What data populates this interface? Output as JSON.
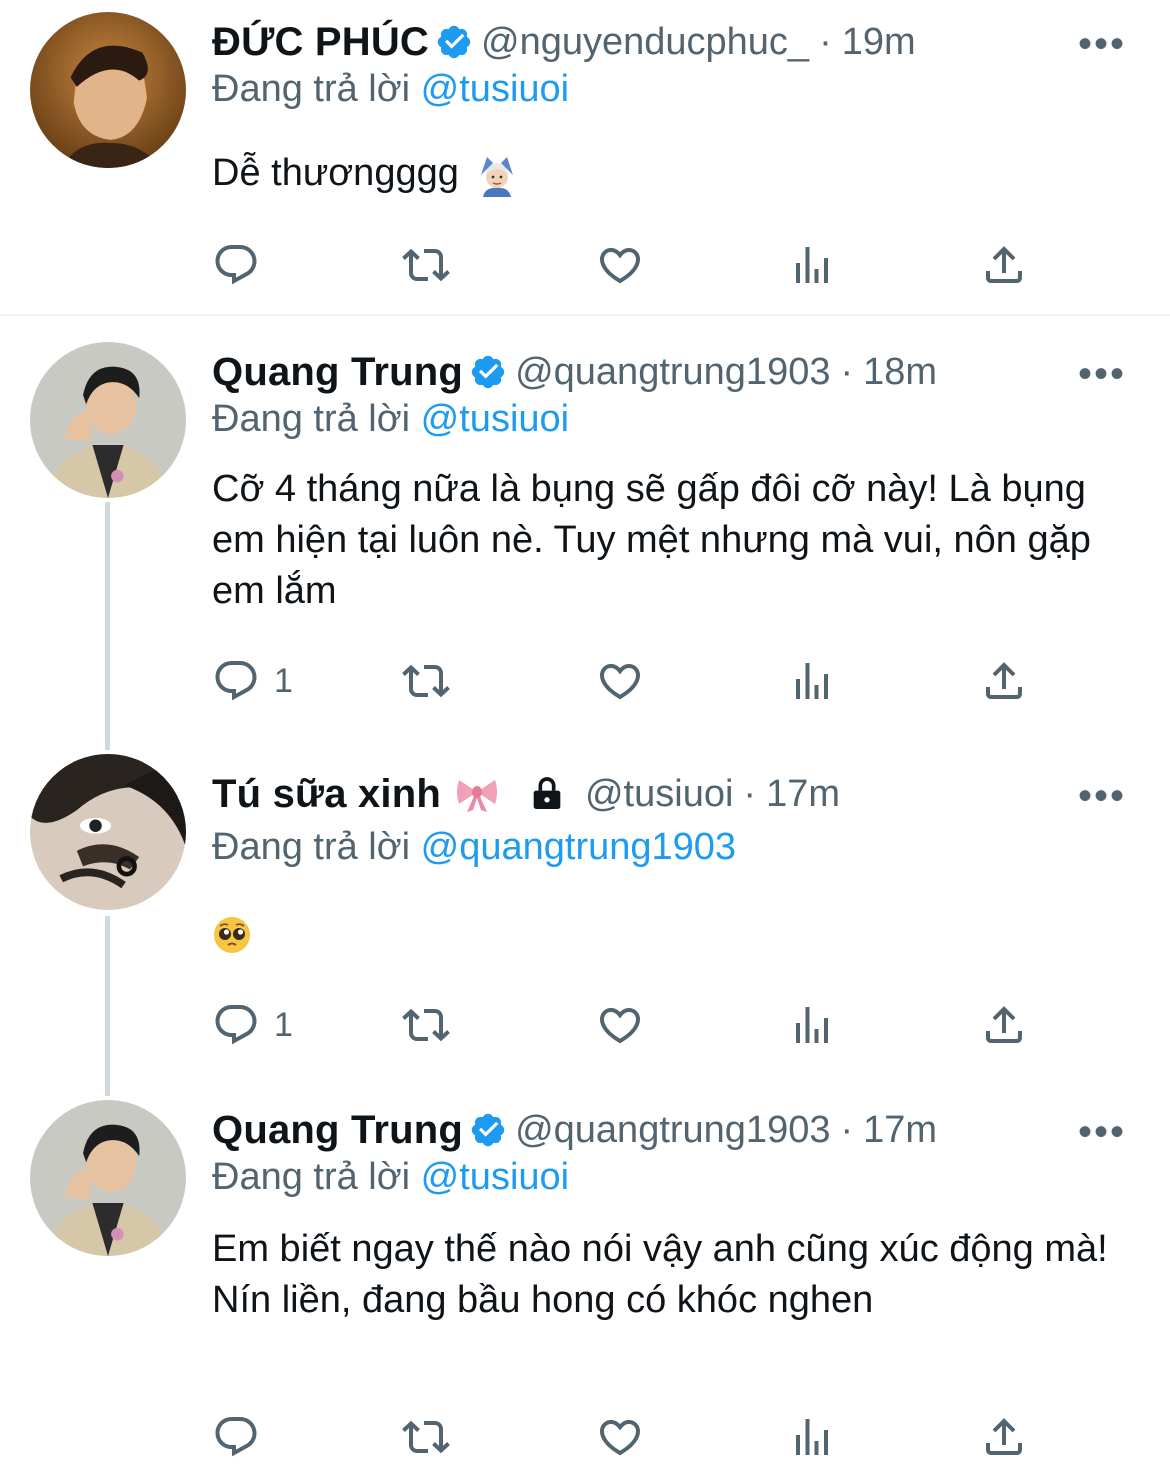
{
  "tweets": [
    {
      "name": "ĐỨC PHÚC",
      "handle": "@nguyenducphuc_",
      "sep": "·",
      "time": "19m",
      "reply_prefix": "Đang trả lời",
      "reply_to": "@tusiuoi",
      "text": "Dễ thươngggg",
      "emoji": "man-gesturing-ok-emoji",
      "reply_count": "",
      "more": "•••"
    },
    {
      "name": "Quang Trung",
      "handle": "@quangtrung1903",
      "sep": "·",
      "time": "18m",
      "reply_prefix": "Đang trả lời",
      "reply_to": "@tusiuoi",
      "text": "Cỡ 4 tháng nữa là bụng sẽ gấp đôi cỡ này! Là bụng em hiện tại luôn nè. Tuy mệt nhưng mà vui, nôn gặp em lắm",
      "reply_count": "1",
      "more": "•••"
    },
    {
      "name": "Tú sữa xinh",
      "name_emoji": "ribbon-emoji",
      "protected": "lock-icon",
      "handle": "@tusiuoi",
      "sep": "·",
      "time": "17m",
      "reply_prefix": "Đang trả lời",
      "reply_to": "@quangtrung1903",
      "text": "",
      "emoji": "pleading-face-emoji",
      "reply_count": "1",
      "more": "•••"
    },
    {
      "name": "Quang Trung",
      "handle": "@quangtrung1903",
      "sep": "·",
      "time": "17m",
      "reply_prefix": "Đang trả lời",
      "reply_to": "@tusiuoi",
      "text": "Em biết ngay thế nào nói vậy anh cũng xúc động mà! Nín liền, đang bầu hong có khóc nghen",
      "reply_count": "",
      "more": "•••"
    }
  ],
  "colors": {
    "text": "#0f1419",
    "secondary": "#536471",
    "link": "#1d9bf0",
    "verified": "#1d9bf0",
    "thread_line": "#cfd9de"
  },
  "icons": [
    "reply-icon",
    "retweet-icon",
    "like-icon",
    "views-icon",
    "share-icon",
    "verified-badge-icon",
    "more-icon"
  ]
}
